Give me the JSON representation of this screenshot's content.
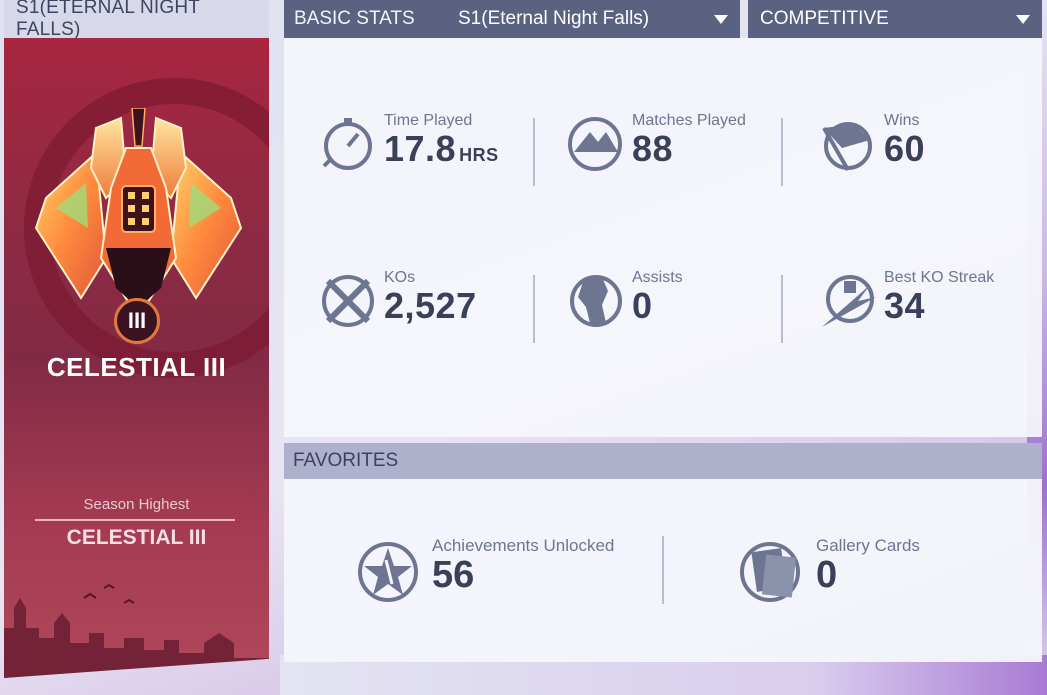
{
  "rank": {
    "season_header": "S1(ETERNAL NIGHT FALLS)",
    "tier_numeral": "III",
    "rank_name": "CELESTIAL III",
    "season_highest_label": "Season Highest",
    "season_highest_value": "CELESTIAL III"
  },
  "tabs": {
    "basic_stats": "BASIC STATS",
    "season_select": "S1(Eternal Night Falls)",
    "mode_select": "COMPETITIVE"
  },
  "stats": [
    {
      "label": "Time Played",
      "value": "17.8",
      "unit": "HRS",
      "icon": "stopwatch-icon"
    },
    {
      "label": "Matches Played",
      "value": "88",
      "unit": "",
      "icon": "mountain-icon"
    },
    {
      "label": "Wins",
      "value": "60",
      "unit": "",
      "icon": "flag-icon"
    },
    {
      "label": "KOs",
      "value": "2,527",
      "unit": "",
      "icon": "crossed-swords-icon"
    },
    {
      "label": "Assists",
      "value": "0",
      "unit": "",
      "icon": "fist-icon"
    },
    {
      "label": "Best KO Streak",
      "value": "34",
      "unit": "",
      "icon": "streak-icon"
    }
  ],
  "favorites": {
    "header": "FAVORITES",
    "items": [
      {
        "label": "Achievements Unlocked",
        "value": "56",
        "icon": "achievement-star-icon"
      },
      {
        "label": "Gallery Cards",
        "value": "0",
        "icon": "gallery-cards-icon"
      }
    ]
  },
  "colors": {
    "tab_bg": "#5b6180",
    "panel_red": "#8e2a43",
    "text_dark": "#3a4058",
    "text_muted": "#6d7590"
  }
}
